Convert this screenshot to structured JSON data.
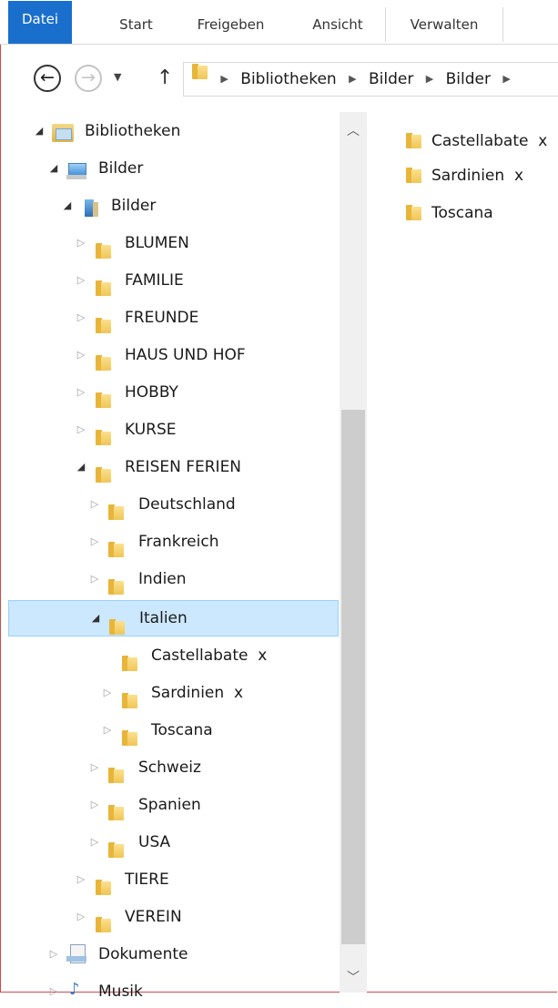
{
  "ribbon": {
    "tabs": [
      "Datei",
      "Start",
      "Freigeben",
      "Ansicht",
      "Verwalten"
    ]
  },
  "address": {
    "back_icon": "back-arrow-icon",
    "forward_icon": "forward-arrow-icon",
    "recent_icon": "chevron-down-icon",
    "up_icon": "up-arrow-icon",
    "crumbs": [
      "Bibliotheken",
      "Bilder",
      "Bilder"
    ]
  },
  "tree": {
    "nodes": [
      {
        "label": "Bibliotheken",
        "state": "open",
        "icon": "library-icon"
      },
      {
        "label": "Bilder",
        "state": "open",
        "icon": "pictures-library-icon"
      },
      {
        "label": "Bilder",
        "state": "open",
        "icon": "pictures-folder-icon"
      },
      {
        "label": "BLUMEN",
        "state": "closed",
        "icon": "folder-icon"
      },
      {
        "label": "FAMILIE",
        "state": "closed",
        "icon": "folder-icon"
      },
      {
        "label": "FREUNDE",
        "state": "closed",
        "icon": "folder-icon"
      },
      {
        "label": "HAUS UND HOF",
        "state": "closed",
        "icon": "folder-icon"
      },
      {
        "label": "HOBBY",
        "state": "closed",
        "icon": "folder-icon"
      },
      {
        "label": "KURSE",
        "state": "closed",
        "icon": "folder-icon"
      },
      {
        "label": "REISEN FERIEN",
        "state": "open",
        "icon": "folder-icon"
      },
      {
        "label": "Deutschland",
        "state": "closed",
        "icon": "folder-icon"
      },
      {
        "label": "Frankreich",
        "state": "closed",
        "icon": "folder-icon"
      },
      {
        "label": "Indien",
        "state": "closed",
        "icon": "folder-icon"
      },
      {
        "label": "Italien",
        "state": "open",
        "icon": "folder-icon",
        "selected": true
      },
      {
        "label": "Castellabate  x",
        "state": "none",
        "icon": "folder-icon"
      },
      {
        "label": "Sardinien  x",
        "state": "closed",
        "icon": "folder-icon"
      },
      {
        "label": "Toscana",
        "state": "closed",
        "icon": "folder-icon"
      },
      {
        "label": "Schweiz",
        "state": "closed",
        "icon": "folder-icon"
      },
      {
        "label": "Spanien",
        "state": "closed",
        "icon": "folder-icon"
      },
      {
        "label": "USA",
        "state": "closed",
        "icon": "folder-icon"
      },
      {
        "label": "TIERE",
        "state": "closed",
        "icon": "folder-icon"
      },
      {
        "label": "VEREIN",
        "state": "closed",
        "icon": "folder-icon"
      },
      {
        "label": "Dokumente",
        "state": "closed",
        "icon": "documents-library-icon"
      },
      {
        "label": "Musik",
        "state": "closed",
        "icon": "music-library-icon"
      }
    ]
  },
  "content": {
    "items": [
      "Castellabate  x",
      "Sardinien  x",
      "Toscana"
    ]
  },
  "colors": {
    "accent": "#1a6fcd",
    "selection": "#cce8ff",
    "selection_border": "#99d1ff",
    "folder": "#f0c656"
  }
}
